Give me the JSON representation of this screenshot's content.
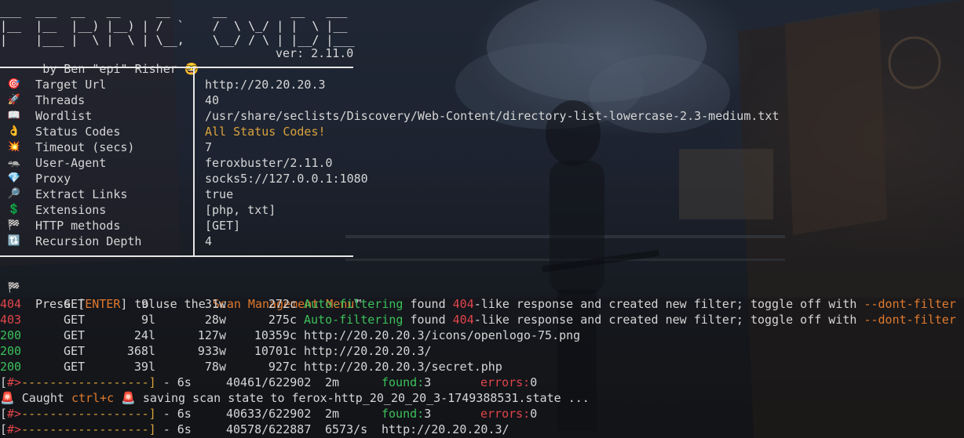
{
  "banner": {
    "line1": "___  ___  __   __     __      __         __   ___",
    "line2": "|__  |__  |__) |__) | /  `    /  \\ \\_/ | |  \\ |__",
    "line3": "|    |___ |  \\ |  \\ | \\__,    \\__/ / \\ | |__/ |___",
    "author": "by Ben \"epi\" Risher",
    "author_emoji": "🤓",
    "version": "ver: 2.11.0"
  },
  "config": [
    {
      "icon": "🎯",
      "icon_name": "target-icon",
      "key": "Target Url",
      "value": "http://20.20.20.3",
      "color": "#d6d6d6"
    },
    {
      "icon": "🚀",
      "icon_name": "rocket-icon",
      "key": "Threads",
      "value": "40",
      "color": "#d6d6d6"
    },
    {
      "icon": "📖",
      "icon_name": "book-icon",
      "key": "Wordlist",
      "value": "/usr/share/seclists/Discovery/Web-Content/directory-list-lowercase-2.3-medium.txt",
      "color": "#d6d6d6"
    },
    {
      "icon": "👌",
      "icon_name": "ok-hand-icon",
      "key": "Status Codes",
      "value": "All Status Codes!",
      "color": "#d9a23c"
    },
    {
      "icon": "💥",
      "icon_name": "collision-icon",
      "key": "Timeout (secs)",
      "value": "7",
      "color": "#d6d6d6"
    },
    {
      "icon": "🦡",
      "icon_name": "badger-icon",
      "key": "User-Agent",
      "value": "feroxbuster/2.11.0",
      "color": "#d6d6d6"
    },
    {
      "icon": "💎",
      "icon_name": "gem-icon",
      "key": "Proxy",
      "value": "socks5://127.0.0.1:1080",
      "color": "#d6d6d6"
    },
    {
      "icon": "🔎",
      "icon_name": "magnifier-icon",
      "key": "Extract Links",
      "value": "true",
      "color": "#d6d6d6"
    },
    {
      "icon": "💲",
      "icon_name": "dollar-icon",
      "key": "Extensions",
      "value": "[php, txt]",
      "color": "#d6d6d6"
    },
    {
      "icon": "🏁",
      "icon_name": "checkered-flag-icon",
      "key": "HTTP methods",
      "value": "[GET]",
      "color": "#d6d6d6"
    },
    {
      "icon": "🔃",
      "icon_name": "refresh-icon",
      "key": "Recursion Depth",
      "value": "4",
      "color": "#d6d6d6"
    }
  ],
  "press_line": {
    "icon": "🏁",
    "prefix": "Press [",
    "key": "ENTER",
    "middle": "] to use the ",
    "menu": "Scan Management Menu",
    "suffix": "™"
  },
  "results": [
    {
      "status": "404",
      "status_color": "#e0454a",
      "method": "GET",
      "lines": "9l",
      "words": "31w",
      "chars": "272c",
      "type": "filter",
      "tag": "Auto-filtering",
      "text1": " found ",
      "code": "404",
      "text2": "-like response and created new filter; toggle off with ",
      "flag": "--dont-filter"
    },
    {
      "status": "403",
      "status_color": "#e0454a",
      "method": "GET",
      "lines": "9l",
      "words": "28w",
      "chars": "275c",
      "type": "filter",
      "tag": "Auto-filtering",
      "text1": " found ",
      "code": "404",
      "text2": "-like response and created new filter; toggle off with ",
      "flag": "--dont-filter"
    },
    {
      "status": "200",
      "status_color": "#3cc05a",
      "method": "GET",
      "lines": "24l",
      "words": "127w",
      "chars": "10359c",
      "type": "url",
      "url": "http://20.20.20.3/icons/openlogo-75.png"
    },
    {
      "status": "200",
      "status_color": "#3cc05a",
      "method": "GET",
      "lines": "368l",
      "words": "933w",
      "chars": "10701c",
      "type": "url",
      "url": "http://20.20.20.3/"
    },
    {
      "status": "200",
      "status_color": "#3cc05a",
      "method": "GET",
      "lines": "39l",
      "words": "78w",
      "chars": "927c",
      "type": "url",
      "url": "http://20.20.20.3/secret.php"
    }
  ],
  "progress": [
    {
      "bar_head": "[",
      "bar_hash": "#>",
      "bar_tail": "------------------]",
      "elapsed": " - 6s",
      "count": "40461/622902",
      "eta": "2m",
      "found_label": "found:",
      "found": "3",
      "errors_label": "errors:",
      "errors": "0",
      "fraction": 0.065
    },
    {
      "bar_head": "[",
      "bar_hash": "#>",
      "bar_tail": "------------------]",
      "elapsed": " - 6s",
      "count": "40633/622902",
      "eta": "2m",
      "found_label": "found:",
      "found": "3",
      "errors_label": "errors:",
      "errors": "0",
      "fraction": 0.065
    },
    {
      "bar_head": "[",
      "bar_hash": "#>",
      "bar_tail": "------------------]",
      "elapsed": " - 6s",
      "count": "40578/622887",
      "eta": "6573/s",
      "url": "http://20.20.20.3/",
      "fraction": 0.065
    }
  ],
  "ctrlc": {
    "icon": "🚨",
    "caught": "Caught ",
    "combo": "ctrl+c",
    "icon2": "🚨",
    "message": " saving scan state to ferox-http_20_20_20_3-1749388531.state ..."
  }
}
